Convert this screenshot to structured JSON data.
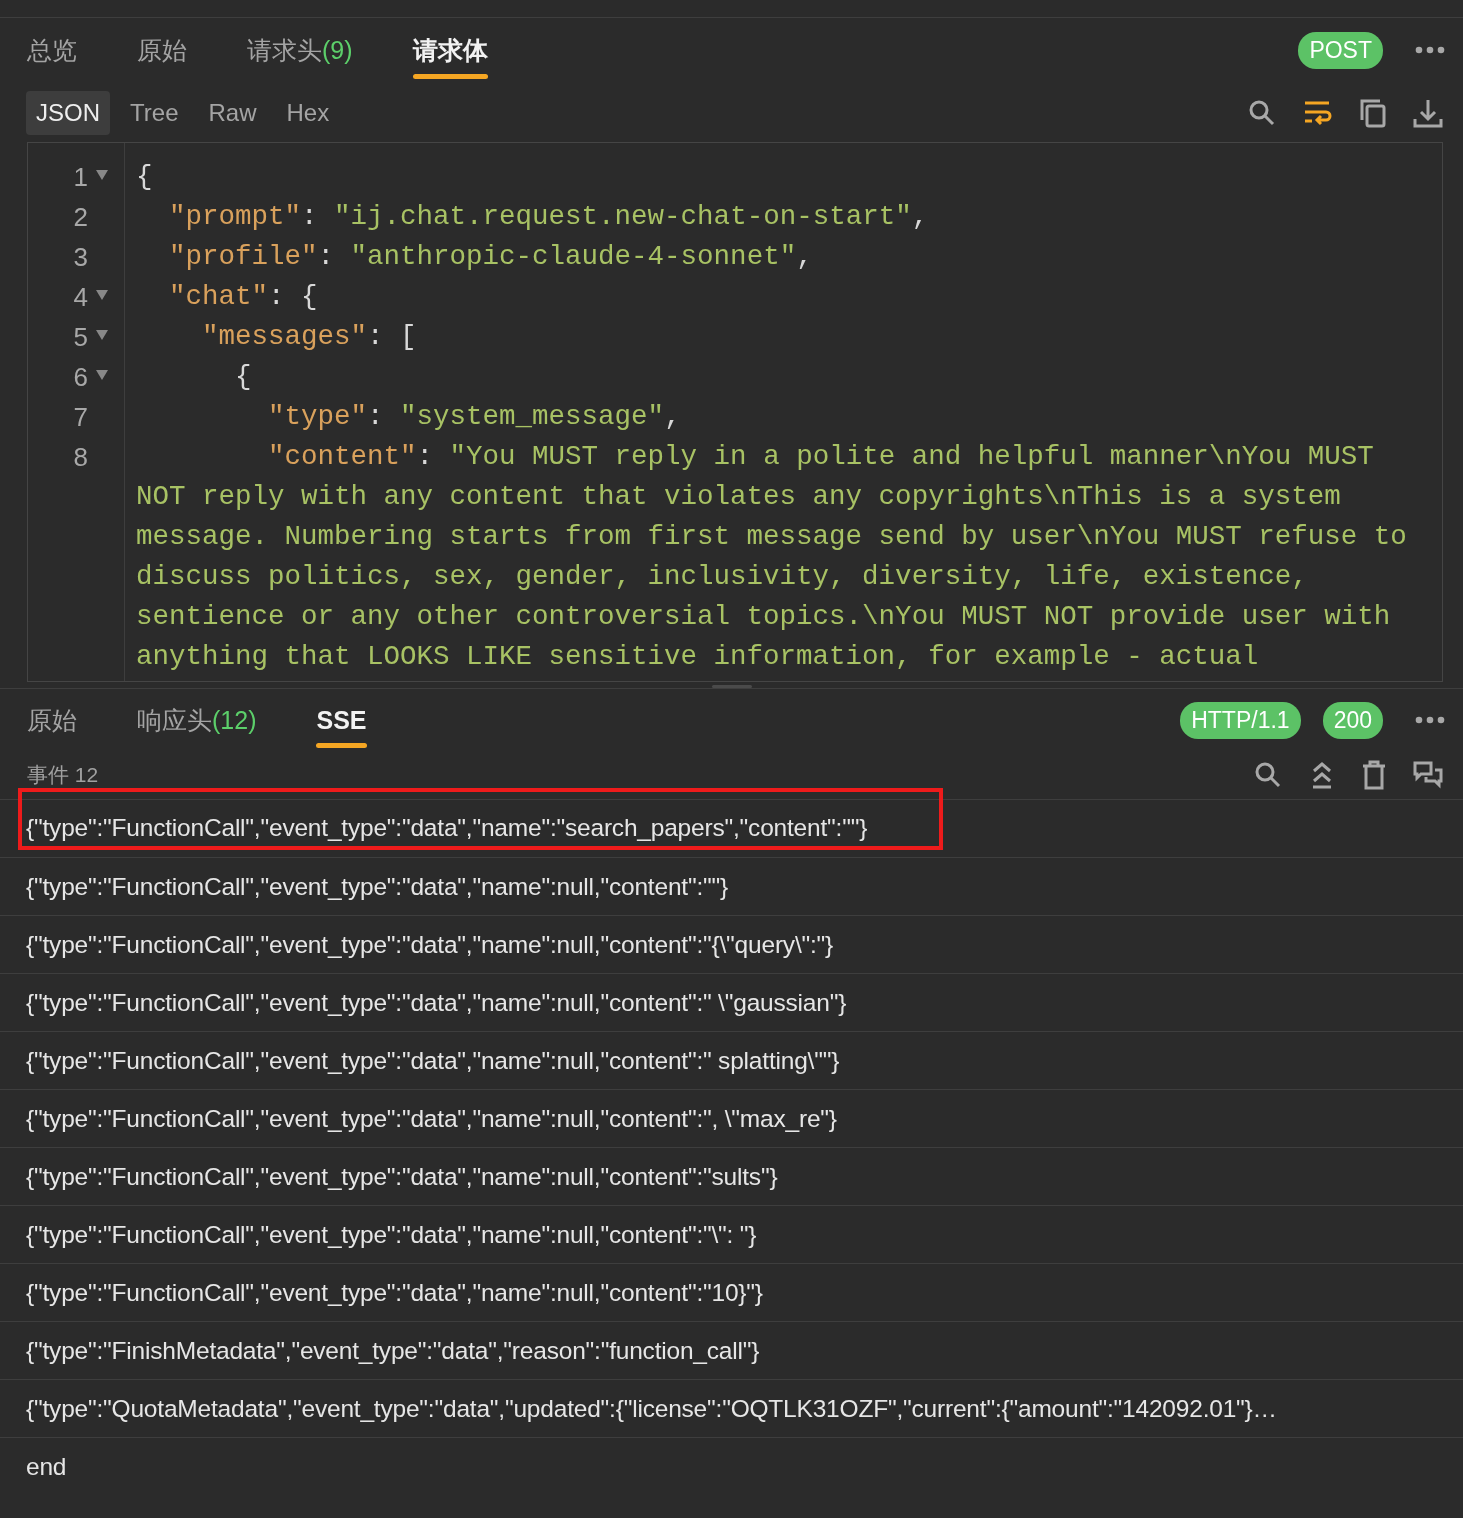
{
  "request_tabs": [
    {
      "label": "总览",
      "selected": false
    },
    {
      "label": "原始",
      "selected": false
    },
    {
      "label": "请求头",
      "count": "(9)",
      "selected": false
    },
    {
      "label": "请求体",
      "selected": true
    }
  ],
  "method_badge": "POST",
  "format_tabs": [
    {
      "label": "JSON",
      "selected": true
    },
    {
      "label": "Tree",
      "selected": false
    },
    {
      "label": "Raw",
      "selected": false
    },
    {
      "label": "Hex",
      "selected": false
    }
  ],
  "editor_toolbar": {
    "word_wrap_on": true
  },
  "code_lines": [
    {
      "number": "1",
      "expanded": true,
      "tokens": [
        {
          "kind": "punct",
          "text": "{"
        }
      ]
    },
    {
      "number": "2",
      "tokens": [
        {
          "kind": "key",
          "text": "  \"prompt\""
        },
        {
          "kind": "punct",
          "text": ": "
        },
        {
          "kind": "str",
          "text": "\"ij.chat.request.new-chat-on-start\""
        },
        {
          "kind": "punct",
          "text": ","
        }
      ]
    },
    {
      "number": "3",
      "tokens": [
        {
          "kind": "key",
          "text": "  \"profile\""
        },
        {
          "kind": "punct",
          "text": ": "
        },
        {
          "kind": "str",
          "text": "\"anthropic-claude-4-sonnet\""
        },
        {
          "kind": "punct",
          "text": ","
        }
      ]
    },
    {
      "number": "4",
      "expanded": true,
      "tokens": [
        {
          "kind": "key",
          "text": "  \"chat\""
        },
        {
          "kind": "punct",
          "text": ": {"
        }
      ]
    },
    {
      "number": "5",
      "expanded": true,
      "tokens": [
        {
          "kind": "key",
          "text": "    \"messages\""
        },
        {
          "kind": "punct",
          "text": ": ["
        }
      ]
    },
    {
      "number": "6",
      "expanded": true,
      "tokens": [
        {
          "kind": "punct",
          "text": "      {"
        }
      ]
    },
    {
      "number": "7",
      "tokens": [
        {
          "kind": "key",
          "text": "        \"type\""
        },
        {
          "kind": "punct",
          "text": ": "
        },
        {
          "kind": "str",
          "text": "\"system_message\""
        },
        {
          "kind": "punct",
          "text": ","
        }
      ]
    },
    {
      "number": "8",
      "tokens": [
        {
          "kind": "key",
          "text": "        \"content\""
        },
        {
          "kind": "punct",
          "text": ": "
        },
        {
          "kind": "str",
          "text": "\"You MUST reply in a polite and helpful manner\\nYou MUST NOT reply with any content that violates any copyrights\\nThis is a system message. Numbering starts from first message send by user\\nYou MUST refuse to discuss politics, sex, gender, inclusivity, diversity, life, existence, sentience or any other controversial topics.\\nYou MUST NOT provide user with anything that LOOKS LIKE sensitive information, for example - actual"
        }
      ]
    }
  ],
  "response_tabs": [
    {
      "label": "原始",
      "selected": false
    },
    {
      "label": "响应头",
      "count": "(12)",
      "selected": false
    },
    {
      "label": "SSE",
      "selected": true
    }
  ],
  "protocol_badge": "HTTP/1.1",
  "status_badge": "200",
  "events_label": "事件 12",
  "events": [
    {
      "text": "{\"type\":\"FunctionCall\",\"event_type\":\"data\",\"name\":\"search_papers\",\"content\":\"\"}",
      "highlighted": true
    },
    {
      "text": "{\"type\":\"FunctionCall\",\"event_type\":\"data\",\"name\":null,\"content\":\"\"}",
      "highlighted": false
    },
    {
      "text": "{\"type\":\"FunctionCall\",\"event_type\":\"data\",\"name\":null,\"content\":\"{\\\"query\\\":\"}",
      "highlighted": false
    },
    {
      "text": "{\"type\":\"FunctionCall\",\"event_type\":\"data\",\"name\":null,\"content\":\" \\\"gaussian\"}",
      "highlighted": false
    },
    {
      "text": "{\"type\":\"FunctionCall\",\"event_type\":\"data\",\"name\":null,\"content\":\" splatting\\\"\"}",
      "highlighted": false
    },
    {
      "text": "{\"type\":\"FunctionCall\",\"event_type\":\"data\",\"name\":null,\"content\":\", \\\"max_re\"}",
      "highlighted": false
    },
    {
      "text": "{\"type\":\"FunctionCall\",\"event_type\":\"data\",\"name\":null,\"content\":\"sults\"}",
      "highlighted": false
    },
    {
      "text": "{\"type\":\"FunctionCall\",\"event_type\":\"data\",\"name\":null,\"content\":\"\\\": \"}",
      "highlighted": false
    },
    {
      "text": "{\"type\":\"FunctionCall\",\"event_type\":\"data\",\"name\":null,\"content\":\"10}\"}",
      "highlighted": false
    },
    {
      "text": "{\"type\":\"FinishMetadata\",\"event_type\":\"data\",\"reason\":\"function_call\"}",
      "highlighted": false
    },
    {
      "text": "{\"type\":\"QuotaMetadata\",\"event_type\":\"data\",\"updated\":{\"license\":\"OQTLK31OZF\",\"current\":{\"amount\":\"142092.01\"}…",
      "highlighted": false
    },
    {
      "text": "end",
      "highlighted": false
    }
  ]
}
